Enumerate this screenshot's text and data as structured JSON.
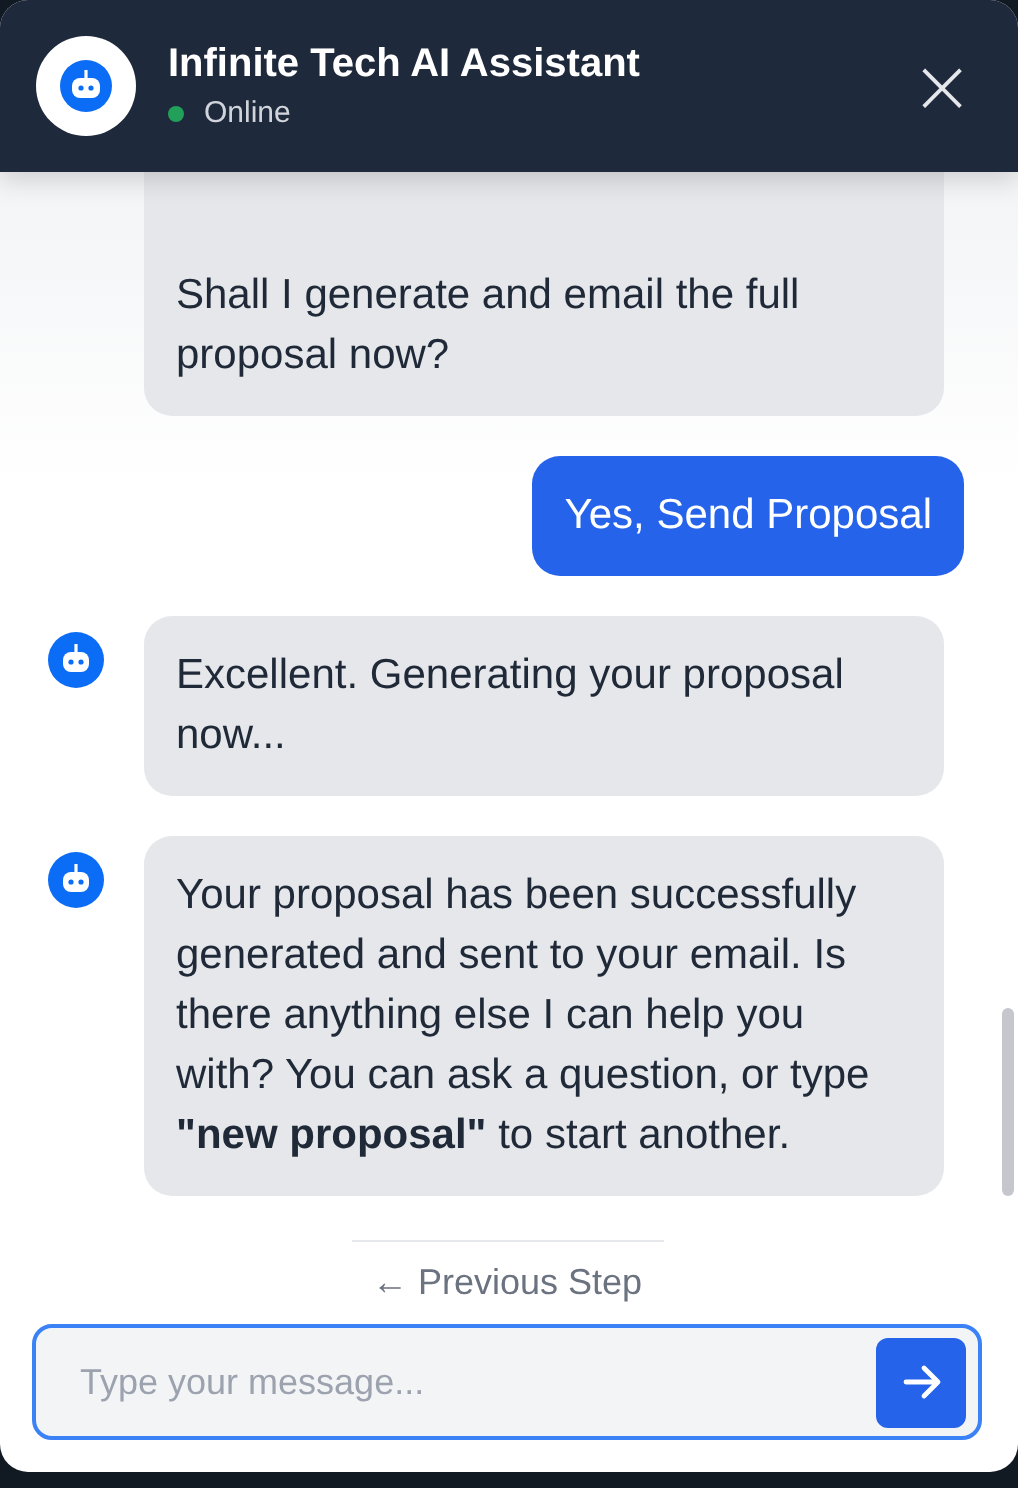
{
  "header": {
    "title": "Infinite Tech AI Assistant",
    "status": "Online",
    "online": true,
    "close": "×"
  },
  "messages": [
    {
      "kind": "bot",
      "show_avatar": false,
      "paragraphs": [
        "Shall I generate and email the full proposal now?"
      ]
    },
    {
      "kind": "user",
      "paragraphs": [
        "Yes, Send Proposal"
      ]
    },
    {
      "kind": "bot",
      "show_avatar": true,
      "paragraphs": [
        "Excellent. Generating your proposal now..."
      ]
    },
    {
      "kind": "bot",
      "show_avatar": true,
      "paragraphs": [
        "Your proposal has been successfully generated and sent to your email. Is there anything else I can help you with? You can ask a question, or type **\"new proposal\"** to start another."
      ]
    }
  ],
  "footer": {
    "previous_step": "← Previous Step",
    "input": {
      "placeholder": "Type your message..."
    }
  }
}
